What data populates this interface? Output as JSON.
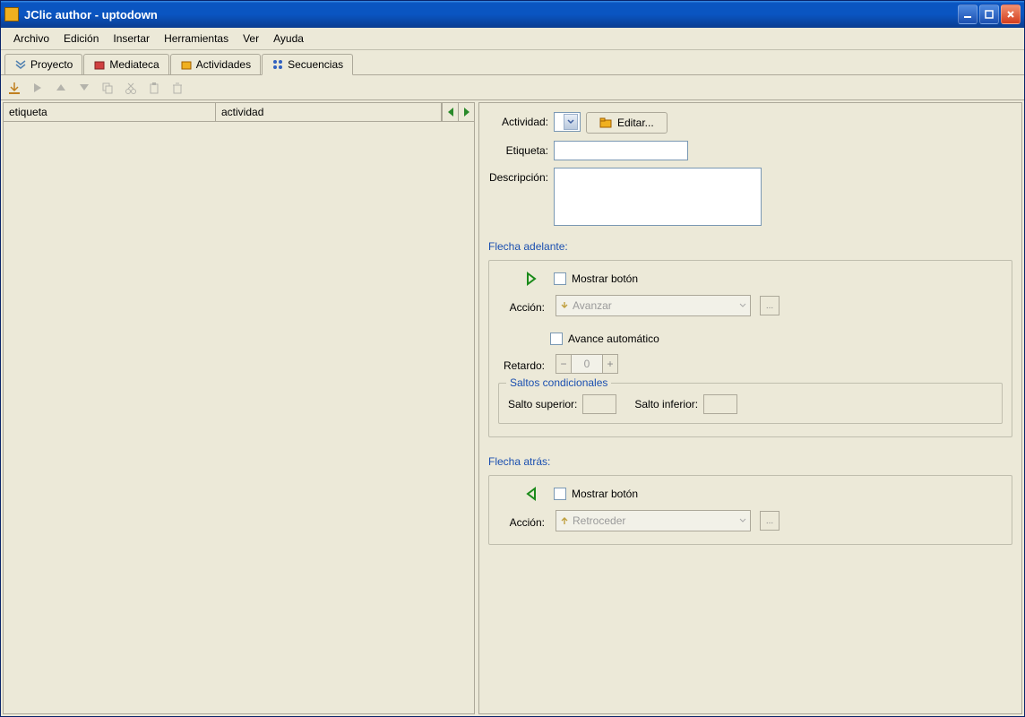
{
  "window": {
    "title": "JClic author - uptodown"
  },
  "menu": {
    "archivo": "Archivo",
    "edicion": "Edición",
    "insertar": "Insertar",
    "herramientas": "Herramientas",
    "ver": "Ver",
    "ayuda": "Ayuda"
  },
  "tabs": {
    "proyecto": "Proyecto",
    "mediateca": "Mediateca",
    "actividades": "Actividades",
    "secuencias": "Secuencias"
  },
  "list": {
    "header_etiqueta": "etiqueta",
    "header_actividad": "actividad"
  },
  "form": {
    "actividad_label": "Actividad:",
    "editar_btn": "Editar...",
    "etiqueta_label": "Etiqueta:",
    "descripcion_label": "Descripción:"
  },
  "forward": {
    "title": "Flecha adelante:",
    "mostrar": "Mostrar botón",
    "accion_label": "Acción:",
    "accion_value": "Avanzar",
    "auto": "Avance automático",
    "retardo_label": "Retardo:",
    "retardo_value": "0",
    "saltos_title": "Saltos condicionales",
    "salto_superior": "Salto superior:",
    "salto_inferior": "Salto inferior:"
  },
  "back": {
    "title": "Flecha atrás:",
    "mostrar": "Mostrar botón",
    "accion_label": "Acción:",
    "accion_value": "Retroceder"
  }
}
